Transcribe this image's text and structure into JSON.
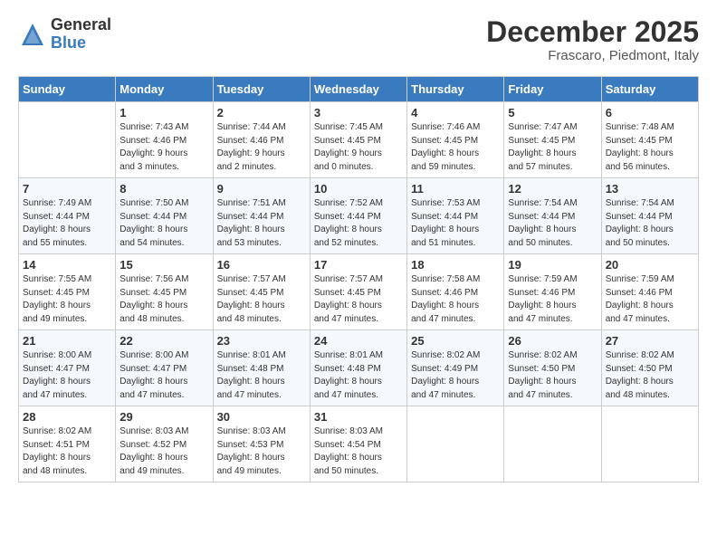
{
  "logo": {
    "general": "General",
    "blue": "Blue"
  },
  "title": {
    "month": "December 2025",
    "location": "Frascaro, Piedmont, Italy"
  },
  "days_of_week": [
    "Sunday",
    "Monday",
    "Tuesday",
    "Wednesday",
    "Thursday",
    "Friday",
    "Saturday"
  ],
  "weeks": [
    [
      {
        "day": "",
        "content": ""
      },
      {
        "day": "1",
        "content": "Sunrise: 7:43 AM\nSunset: 4:46 PM\nDaylight: 9 hours\nand 3 minutes."
      },
      {
        "day": "2",
        "content": "Sunrise: 7:44 AM\nSunset: 4:46 PM\nDaylight: 9 hours\nand 2 minutes."
      },
      {
        "day": "3",
        "content": "Sunrise: 7:45 AM\nSunset: 4:45 PM\nDaylight: 9 hours\nand 0 minutes."
      },
      {
        "day": "4",
        "content": "Sunrise: 7:46 AM\nSunset: 4:45 PM\nDaylight: 8 hours\nand 59 minutes."
      },
      {
        "day": "5",
        "content": "Sunrise: 7:47 AM\nSunset: 4:45 PM\nDaylight: 8 hours\nand 57 minutes."
      },
      {
        "day": "6",
        "content": "Sunrise: 7:48 AM\nSunset: 4:45 PM\nDaylight: 8 hours\nand 56 minutes."
      }
    ],
    [
      {
        "day": "7",
        "content": "Sunrise: 7:49 AM\nSunset: 4:44 PM\nDaylight: 8 hours\nand 55 minutes."
      },
      {
        "day": "8",
        "content": "Sunrise: 7:50 AM\nSunset: 4:44 PM\nDaylight: 8 hours\nand 54 minutes."
      },
      {
        "day": "9",
        "content": "Sunrise: 7:51 AM\nSunset: 4:44 PM\nDaylight: 8 hours\nand 53 minutes."
      },
      {
        "day": "10",
        "content": "Sunrise: 7:52 AM\nSunset: 4:44 PM\nDaylight: 8 hours\nand 52 minutes."
      },
      {
        "day": "11",
        "content": "Sunrise: 7:53 AM\nSunset: 4:44 PM\nDaylight: 8 hours\nand 51 minutes."
      },
      {
        "day": "12",
        "content": "Sunrise: 7:54 AM\nSunset: 4:44 PM\nDaylight: 8 hours\nand 50 minutes."
      },
      {
        "day": "13",
        "content": "Sunrise: 7:54 AM\nSunset: 4:44 PM\nDaylight: 8 hours\nand 50 minutes."
      }
    ],
    [
      {
        "day": "14",
        "content": "Sunrise: 7:55 AM\nSunset: 4:45 PM\nDaylight: 8 hours\nand 49 minutes."
      },
      {
        "day": "15",
        "content": "Sunrise: 7:56 AM\nSunset: 4:45 PM\nDaylight: 8 hours\nand 48 minutes."
      },
      {
        "day": "16",
        "content": "Sunrise: 7:57 AM\nSunset: 4:45 PM\nDaylight: 8 hours\nand 48 minutes."
      },
      {
        "day": "17",
        "content": "Sunrise: 7:57 AM\nSunset: 4:45 PM\nDaylight: 8 hours\nand 47 minutes."
      },
      {
        "day": "18",
        "content": "Sunrise: 7:58 AM\nSunset: 4:46 PM\nDaylight: 8 hours\nand 47 minutes."
      },
      {
        "day": "19",
        "content": "Sunrise: 7:59 AM\nSunset: 4:46 PM\nDaylight: 8 hours\nand 47 minutes."
      },
      {
        "day": "20",
        "content": "Sunrise: 7:59 AM\nSunset: 4:46 PM\nDaylight: 8 hours\nand 47 minutes."
      }
    ],
    [
      {
        "day": "21",
        "content": "Sunrise: 8:00 AM\nSunset: 4:47 PM\nDaylight: 8 hours\nand 47 minutes."
      },
      {
        "day": "22",
        "content": "Sunrise: 8:00 AM\nSunset: 4:47 PM\nDaylight: 8 hours\nand 47 minutes."
      },
      {
        "day": "23",
        "content": "Sunrise: 8:01 AM\nSunset: 4:48 PM\nDaylight: 8 hours\nand 47 minutes."
      },
      {
        "day": "24",
        "content": "Sunrise: 8:01 AM\nSunset: 4:48 PM\nDaylight: 8 hours\nand 47 minutes."
      },
      {
        "day": "25",
        "content": "Sunrise: 8:02 AM\nSunset: 4:49 PM\nDaylight: 8 hours\nand 47 minutes."
      },
      {
        "day": "26",
        "content": "Sunrise: 8:02 AM\nSunset: 4:50 PM\nDaylight: 8 hours\nand 47 minutes."
      },
      {
        "day": "27",
        "content": "Sunrise: 8:02 AM\nSunset: 4:50 PM\nDaylight: 8 hours\nand 48 minutes."
      }
    ],
    [
      {
        "day": "28",
        "content": "Sunrise: 8:02 AM\nSunset: 4:51 PM\nDaylight: 8 hours\nand 48 minutes."
      },
      {
        "day": "29",
        "content": "Sunrise: 8:03 AM\nSunset: 4:52 PM\nDaylight: 8 hours\nand 49 minutes."
      },
      {
        "day": "30",
        "content": "Sunrise: 8:03 AM\nSunset: 4:53 PM\nDaylight: 8 hours\nand 49 minutes."
      },
      {
        "day": "31",
        "content": "Sunrise: 8:03 AM\nSunset: 4:54 PM\nDaylight: 8 hours\nand 50 minutes."
      },
      {
        "day": "",
        "content": ""
      },
      {
        "day": "",
        "content": ""
      },
      {
        "day": "",
        "content": ""
      }
    ]
  ]
}
